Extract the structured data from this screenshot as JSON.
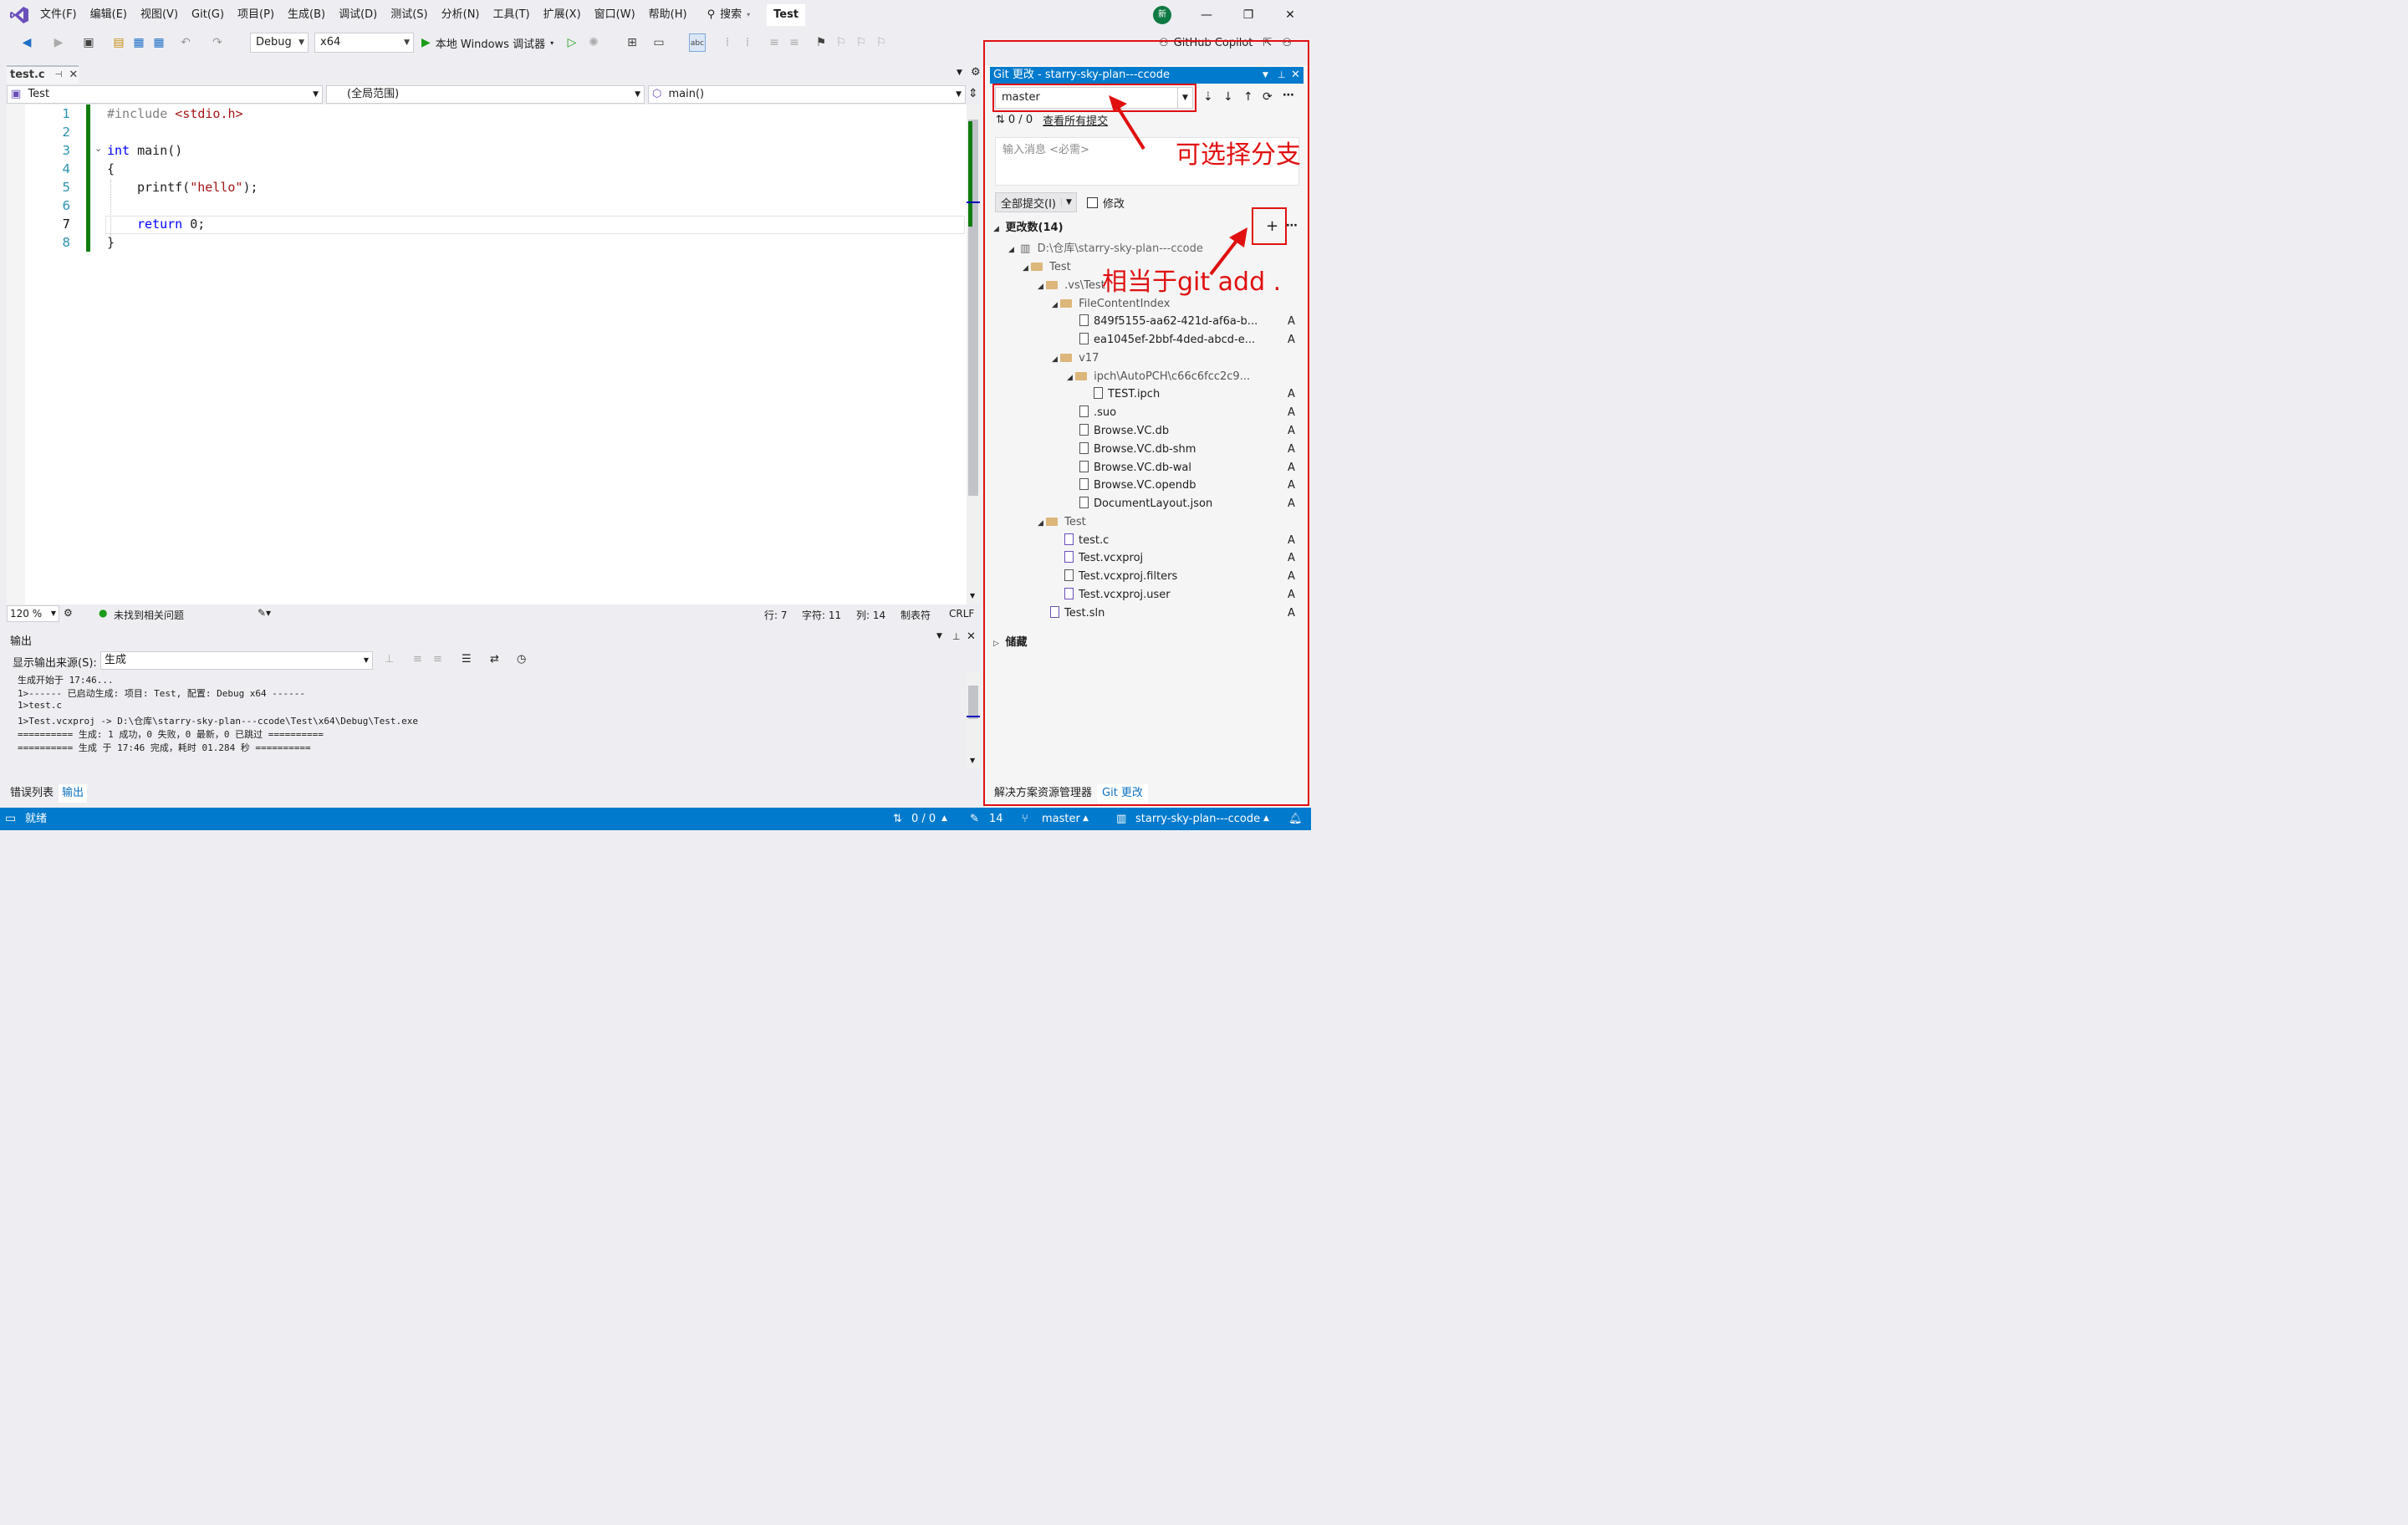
{
  "menubar": {
    "items": [
      "文件(F)",
      "编辑(E)",
      "视图(V)",
      "Git(G)",
      "项目(P)",
      "生成(B)",
      "调试(D)",
      "测试(S)",
      "分析(N)",
      "工具(T)",
      "扩展(X)",
      "窗口(W)",
      "帮助(H)"
    ],
    "search_label": "搜索",
    "project_title": "Test",
    "avatar_initial": "新"
  },
  "toolbar": {
    "config": "Debug",
    "platform": "x64",
    "run_label": "本地 Windows 调试器",
    "copilot_label": "GitHub Copilot"
  },
  "editor": {
    "tab_name": "test.c",
    "nav_project": "Test",
    "nav_scope": "(全局范围)",
    "nav_function": "main()",
    "line_numbers": [
      "1",
      "2",
      "3",
      "4",
      "5",
      "6",
      "7",
      "8"
    ],
    "lines": {
      "l1_pre": "#include ",
      "l1_hdr": "<stdio.h>",
      "l3_kw": "int",
      "l3_rest": " main()",
      "l4": "{",
      "l5_fn": "printf(",
      "l5_str": "\"hello\"",
      "l5_end": ");",
      "l7_kw": "return",
      "l7_rest": " 0;",
      "l8": "}"
    },
    "zoom": "120 %",
    "issues": "未找到相关问题",
    "pos_line": "行: 7",
    "pos_char": "字符: 11",
    "pos_col": "列: 14",
    "tab_mode": "制表符",
    "eol": "CRLF"
  },
  "output": {
    "title": "输出",
    "source_label": "显示输出来源(S):",
    "source_value": "生成",
    "lines": [
      "生成开始于 17:46...",
      "1>------ 已启动生成: 项目: Test, 配置: Debug x64 ------",
      "1>test.c",
      "1>Test.vcxproj -> D:\\仓库\\starry-sky-plan---ccode\\Test\\x64\\Debug\\Test.exe",
      "========== 生成: 1 成功，0 失败，0 最新，0 已跳过 ==========",
      "========== 生成 于 17:46 完成，耗时 01.284 秒 =========="
    ],
    "bottom_tabs": [
      "错误列表",
      "输出"
    ]
  },
  "git": {
    "header": "Git 更改 - starry-sky-plan---ccode",
    "branch": "master",
    "sync_count": "0 / 0",
    "view_all": "查看所有提交",
    "message_placeholder": "输入消息 <必需>",
    "commit_all": "全部提交(I)",
    "amend": "修改",
    "changes_title": "更改数(14)",
    "stash": "储藏",
    "tree": {
      "root": "D:\\仓库\\starry-sky-plan---ccode",
      "test_folder": "Test",
      "vs_test": ".vs\\Test",
      "file_content_index": "FileContentIndex",
      "f1": "849f5155-aa62-421d-af6a-b...",
      "f2": "ea1045ef-2bbf-4ded-abcd-e...",
      "v17": "v17",
      "ipch": "ipch\\AutoPCH\\c66c6fcc2c9...",
      "ipch_file": "TEST.ipch",
      "suo": ".suo",
      "db": "Browse.VC.db",
      "db_shm": "Browse.VC.db-shm",
      "db_wal": "Browse.VC.db-wal",
      "opendb": "Browse.VC.opendb",
      "layout": "DocumentLayout.json",
      "test_inner": "Test",
      "test_c": "test.c",
      "vcxproj": "Test.vcxproj",
      "filters": "Test.vcxproj.filters",
      "user": "Test.vcxproj.user",
      "sln": "Test.sln"
    },
    "status_added": "A",
    "bottom_tabs": [
      "解决方案资源管理器",
      "Git 更改"
    ]
  },
  "annotations": {
    "branch_note": "可选择分支",
    "add_note": "相当于git add ."
  },
  "statusbar": {
    "ready": "就绪",
    "sync": "0 / 0",
    "edits": "14",
    "branch": "master",
    "repo": "starry-sky-plan---ccode"
  },
  "colors": {
    "accent": "#007acc",
    "annotation": "#e01010",
    "modified_bar": "#107c10"
  }
}
